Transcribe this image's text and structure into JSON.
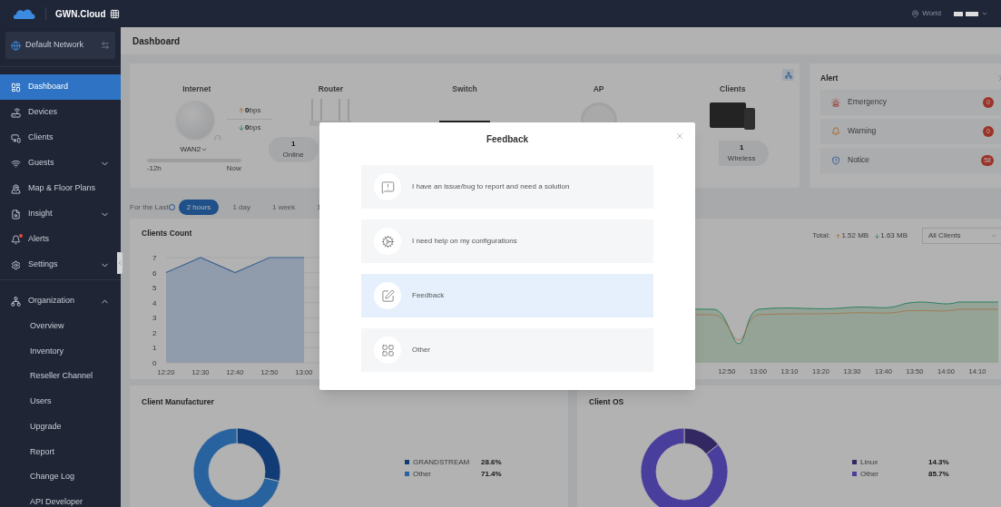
{
  "topbar": {
    "brand": "GWN.Cloud",
    "region": "World"
  },
  "sidebar": {
    "network": "Default Network",
    "items": [
      {
        "label": "Dashboard",
        "selected": true
      },
      {
        "label": "Devices",
        "selected": false
      },
      {
        "label": "Clients",
        "selected": false
      },
      {
        "label": "Guests",
        "selected": false,
        "expanded": false
      },
      {
        "label": "Map & Floor Plans",
        "selected": false
      },
      {
        "label": "Insight",
        "selected": false,
        "expanded": false
      },
      {
        "label": "Alerts",
        "selected": false
      },
      {
        "label": "Settings",
        "selected": false,
        "expanded": false
      },
      {
        "label": "Organization",
        "selected": false,
        "expanded": true,
        "children": [
          {
            "label": "Overview"
          },
          {
            "label": "Inventory"
          },
          {
            "label": "Reseller Channel"
          },
          {
            "label": "Users"
          },
          {
            "label": "Upgrade"
          },
          {
            "label": "Report"
          },
          {
            "label": "Change Log"
          },
          {
            "label": "API Developer"
          }
        ]
      }
    ]
  },
  "page_title": "Dashboard",
  "topology": {
    "internet": {
      "title": "Internet",
      "upload": "0",
      "upload_unit": "bps",
      "download": "0",
      "download_unit": "bps",
      "wan": "WAN2",
      "range_start": "-12h",
      "range_end": "Now"
    },
    "router": {
      "title": "Router",
      "count": "1",
      "label": "Online"
    },
    "switch": {
      "title": "Switch"
    },
    "ap": {
      "title": "AP"
    },
    "clients": {
      "title": "Clients",
      "count": "1",
      "label": "Wireless"
    }
  },
  "alert": {
    "title": "Alert",
    "rows": [
      {
        "kind": "emergency",
        "label": "Emergency",
        "count": "0"
      },
      {
        "kind": "warning",
        "label": "Warning",
        "count": "0"
      },
      {
        "kind": "notice",
        "label": "Notice",
        "count": "58"
      }
    ]
  },
  "range": {
    "label": "For the Last",
    "options": [
      {
        "label": "2 hours",
        "selected": true
      },
      {
        "label": "1 day",
        "selected": false
      },
      {
        "label": "1 week",
        "selected": false
      },
      {
        "label": "1",
        "selected": false
      }
    ]
  },
  "clients_count": {
    "title": "Clients Count",
    "chart_data": {
      "type": "area",
      "categories": [
        "12:20",
        "12:30",
        "12:40",
        "12:50",
        "13:00"
      ],
      "yticks": [
        0,
        1,
        2,
        3,
        4,
        5,
        6,
        7
      ],
      "ylim": [
        0,
        7
      ],
      "values": [
        6,
        7,
        6,
        7,
        7
      ],
      "grid": true
    }
  },
  "traffic": {
    "total_label": "Total:",
    "upload": "1.52 MB",
    "download": "1.63 MB",
    "filter": "All Clients",
    "x_labels": [
      "12:50",
      "13:00",
      "13:10",
      "13:20",
      "13:30",
      "13:40",
      "13:50",
      "14:00",
      "14:10"
    ]
  },
  "manufacturer": {
    "title": "Client Manufacturer",
    "chart_data": {
      "type": "donut",
      "categories": [
        "GRANDSTREAM",
        "Other"
      ],
      "values": [
        28.6,
        71.4
      ],
      "value_labels": [
        "28.6%",
        "71.4%"
      ]
    }
  },
  "os": {
    "title": "Client OS",
    "chart_data": {
      "type": "donut",
      "categories": [
        "Linux",
        "Other"
      ],
      "values": [
        14.3,
        85.7
      ],
      "value_labels": [
        "14.3%",
        "85.7%"
      ]
    }
  },
  "modal": {
    "title": "Feedback",
    "options": [
      {
        "label": "I have an issue/bug to report and need a solution",
        "selected": false
      },
      {
        "label": "I need help on my configurations",
        "selected": false
      },
      {
        "label": "Feedback",
        "selected": true
      },
      {
        "label": "Other",
        "selected": false
      }
    ]
  }
}
